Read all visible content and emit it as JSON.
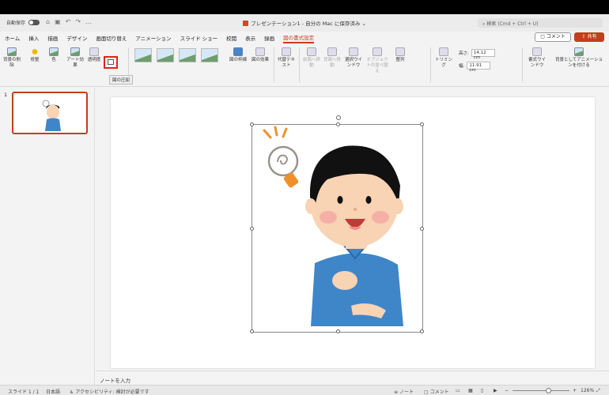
{
  "titlebar": {
    "autosave_label": "自動保存",
    "doc_title": "プレゼンテーション1 - 自分の Mac に保存済み ⌄",
    "search_placeholder": "検索 (Cmd + Ctrl + U)"
  },
  "tabs": [
    "ホーム",
    "挿入",
    "描画",
    "デザイン",
    "画面切り替え",
    "アニメーション",
    "スライド ショー",
    "校閲",
    "表示",
    "録画",
    "図の書式設定"
  ],
  "active_tab": "図の書式設定",
  "header_buttons": {
    "comment": "コメント",
    "share": "共有"
  },
  "ribbon": {
    "remove_bg": "背景の削除",
    "corrections": "修整",
    "color": "色",
    "artistic": "アート効果",
    "transparency": "透明度",
    "compress_tooltip": "図の圧縮",
    "picture_border": "図の枠線",
    "picture_effects": "図の効果",
    "alt_text": "代替テキスト",
    "bring_forward": "前面へ移動",
    "send_backward": "背面へ移動",
    "selection_pane": "選択ウインドウ",
    "arrange_objects": "オブジェクトの並べ替え",
    "align": "整列",
    "crop": "トリミング",
    "height_label": "高さ:",
    "height_value": "14.12 cm",
    "width_label": "幅:",
    "width_value": "11.91 cm",
    "format_pane": "書式ウインドウ",
    "animate_bg": "背景としてアニメーションを付ける"
  },
  "thumbnails": {
    "slide_number": "1"
  },
  "notes": {
    "placeholder": "ノートを入力"
  },
  "statusbar": {
    "slide_info": "スライド 1 / 1",
    "language": "日本語",
    "accessibility": "アクセシビリティ: 検討が必要です",
    "notes_btn": "ノート",
    "comments_btn": "コメント",
    "zoom": "126%",
    "zoom_fraction": 0.62
  },
  "colors": {
    "accent": "#c43e1c",
    "highlight_box": "#e2231a"
  }
}
